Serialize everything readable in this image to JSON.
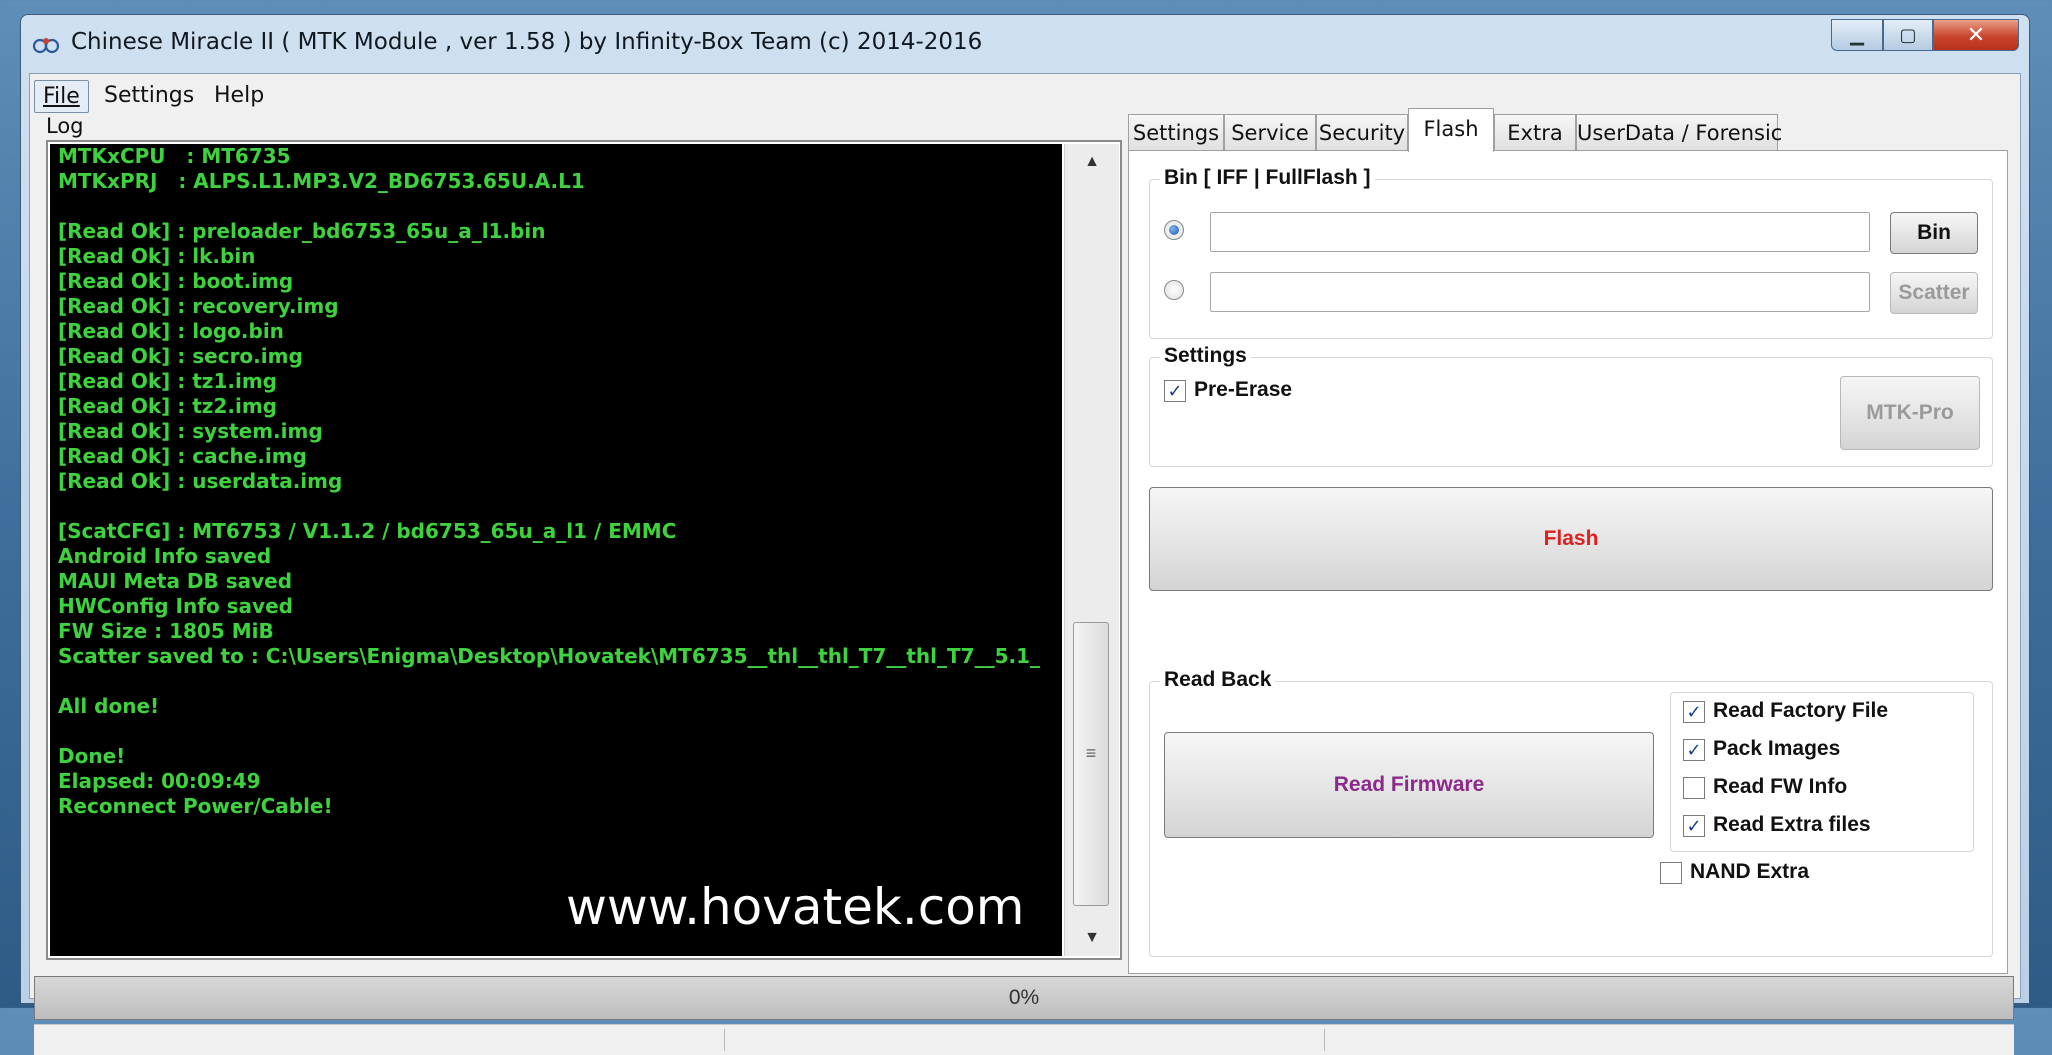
{
  "window": {
    "title": "Chinese Miracle II ( MTK Module , ver 1.58 ) by Infinity-Box Team (c) 2014-2016",
    "min_glyph": "▁",
    "max_glyph": "▢",
    "close_glyph": "✕"
  },
  "menu": {
    "file": "File",
    "settings": "Settings",
    "help": "Help"
  },
  "log": {
    "label": "Log",
    "lines": [
      "MTKxCPU   : MT6735",
      "MTKxPRJ   : ALPS.L1.MP3.V2_BD6753.65U.A.L1",
      "",
      "[Read Ok] : preloader_bd6753_65u_a_l1.bin",
      "[Read Ok] : lk.bin",
      "[Read Ok] : boot.img",
      "[Read Ok] : recovery.img",
      "[Read Ok] : logo.bin",
      "[Read Ok] : secro.img",
      "[Read Ok] : tz1.img",
      "[Read Ok] : tz2.img",
      "[Read Ok] : system.img",
      "[Read Ok] : cache.img",
      "[Read Ok] : userdata.img",
      "",
      "[ScatCFG] : MT6753 / V1.1.2 / bd6753_65u_a_l1 / EMMC",
      "Android Info saved",
      "MAUI Meta DB saved",
      "HWConfig Info saved",
      "FW Size : 1805 MiB",
      "Scatter saved to : C:\\Users\\Enigma\\Desktop\\Hovatek\\MT6735__thl__thl_T7__thl_T7__5.1_",
      "",
      "All done!",
      "",
      "Done!",
      "Elapsed: 00:09:49",
      "Reconnect Power/Cable!"
    ],
    "watermark": "www.hovatek.com"
  },
  "tabs": [
    "Settings",
    "Service",
    "Security",
    "Flash",
    "Extra",
    "UserData / Forensic"
  ],
  "active_tab": "Flash",
  "flash": {
    "bin_group": "Bin  [ IFF | FullFlash ]",
    "bin_button": "Bin",
    "scatter_button": "Scatter",
    "settings_group": "Settings",
    "pre_erase": "Pre-Erase",
    "mtk_pro_button": "MTK-Pro",
    "flash_button": "Flash",
    "readback_group": "Read Back",
    "read_firmware_button": "Read Firmware",
    "options": [
      {
        "label": "Read Factory File",
        "checked": true
      },
      {
        "label": "Pack Images",
        "checked": true
      },
      {
        "label": "Read FW Info",
        "checked": false
      },
      {
        "label": "Read Extra files",
        "checked": true
      }
    ],
    "nand_extra": "NAND Extra"
  },
  "progress": {
    "text": "0%"
  },
  "colors": {
    "log_text": "#3fd23f",
    "flash_text": "#e02020",
    "read_firmware_text": "#8a2a8a"
  }
}
